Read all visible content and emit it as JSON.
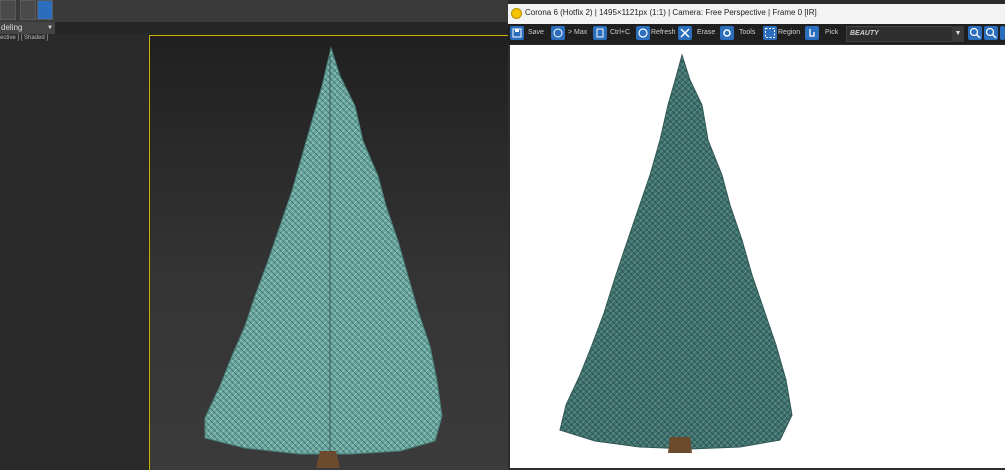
{
  "max": {
    "workspace_label": "deling",
    "viewport_label": "ective ] [ Shaded ]"
  },
  "vfb": {
    "title": "Corona 6 (Hotfix 2) | 1495×1121px (1:1) | Camera: Free Perspective | Frame 0 [IR]",
    "toolbar": {
      "save": "Save",
      "to_max": "> Max",
      "ctrl_c": "Ctrl+C",
      "refresh": "Refresh",
      "erase": "Erase",
      "tools": "Tools",
      "region": "Region",
      "pick": "Pick"
    },
    "render_element": "BEAUTY"
  },
  "colors": {
    "accent": "#2a6ebd",
    "viewport_border": "#c8b400",
    "tree_viewport": "#6fa8a2",
    "tree_render": "#3d6e6c"
  }
}
